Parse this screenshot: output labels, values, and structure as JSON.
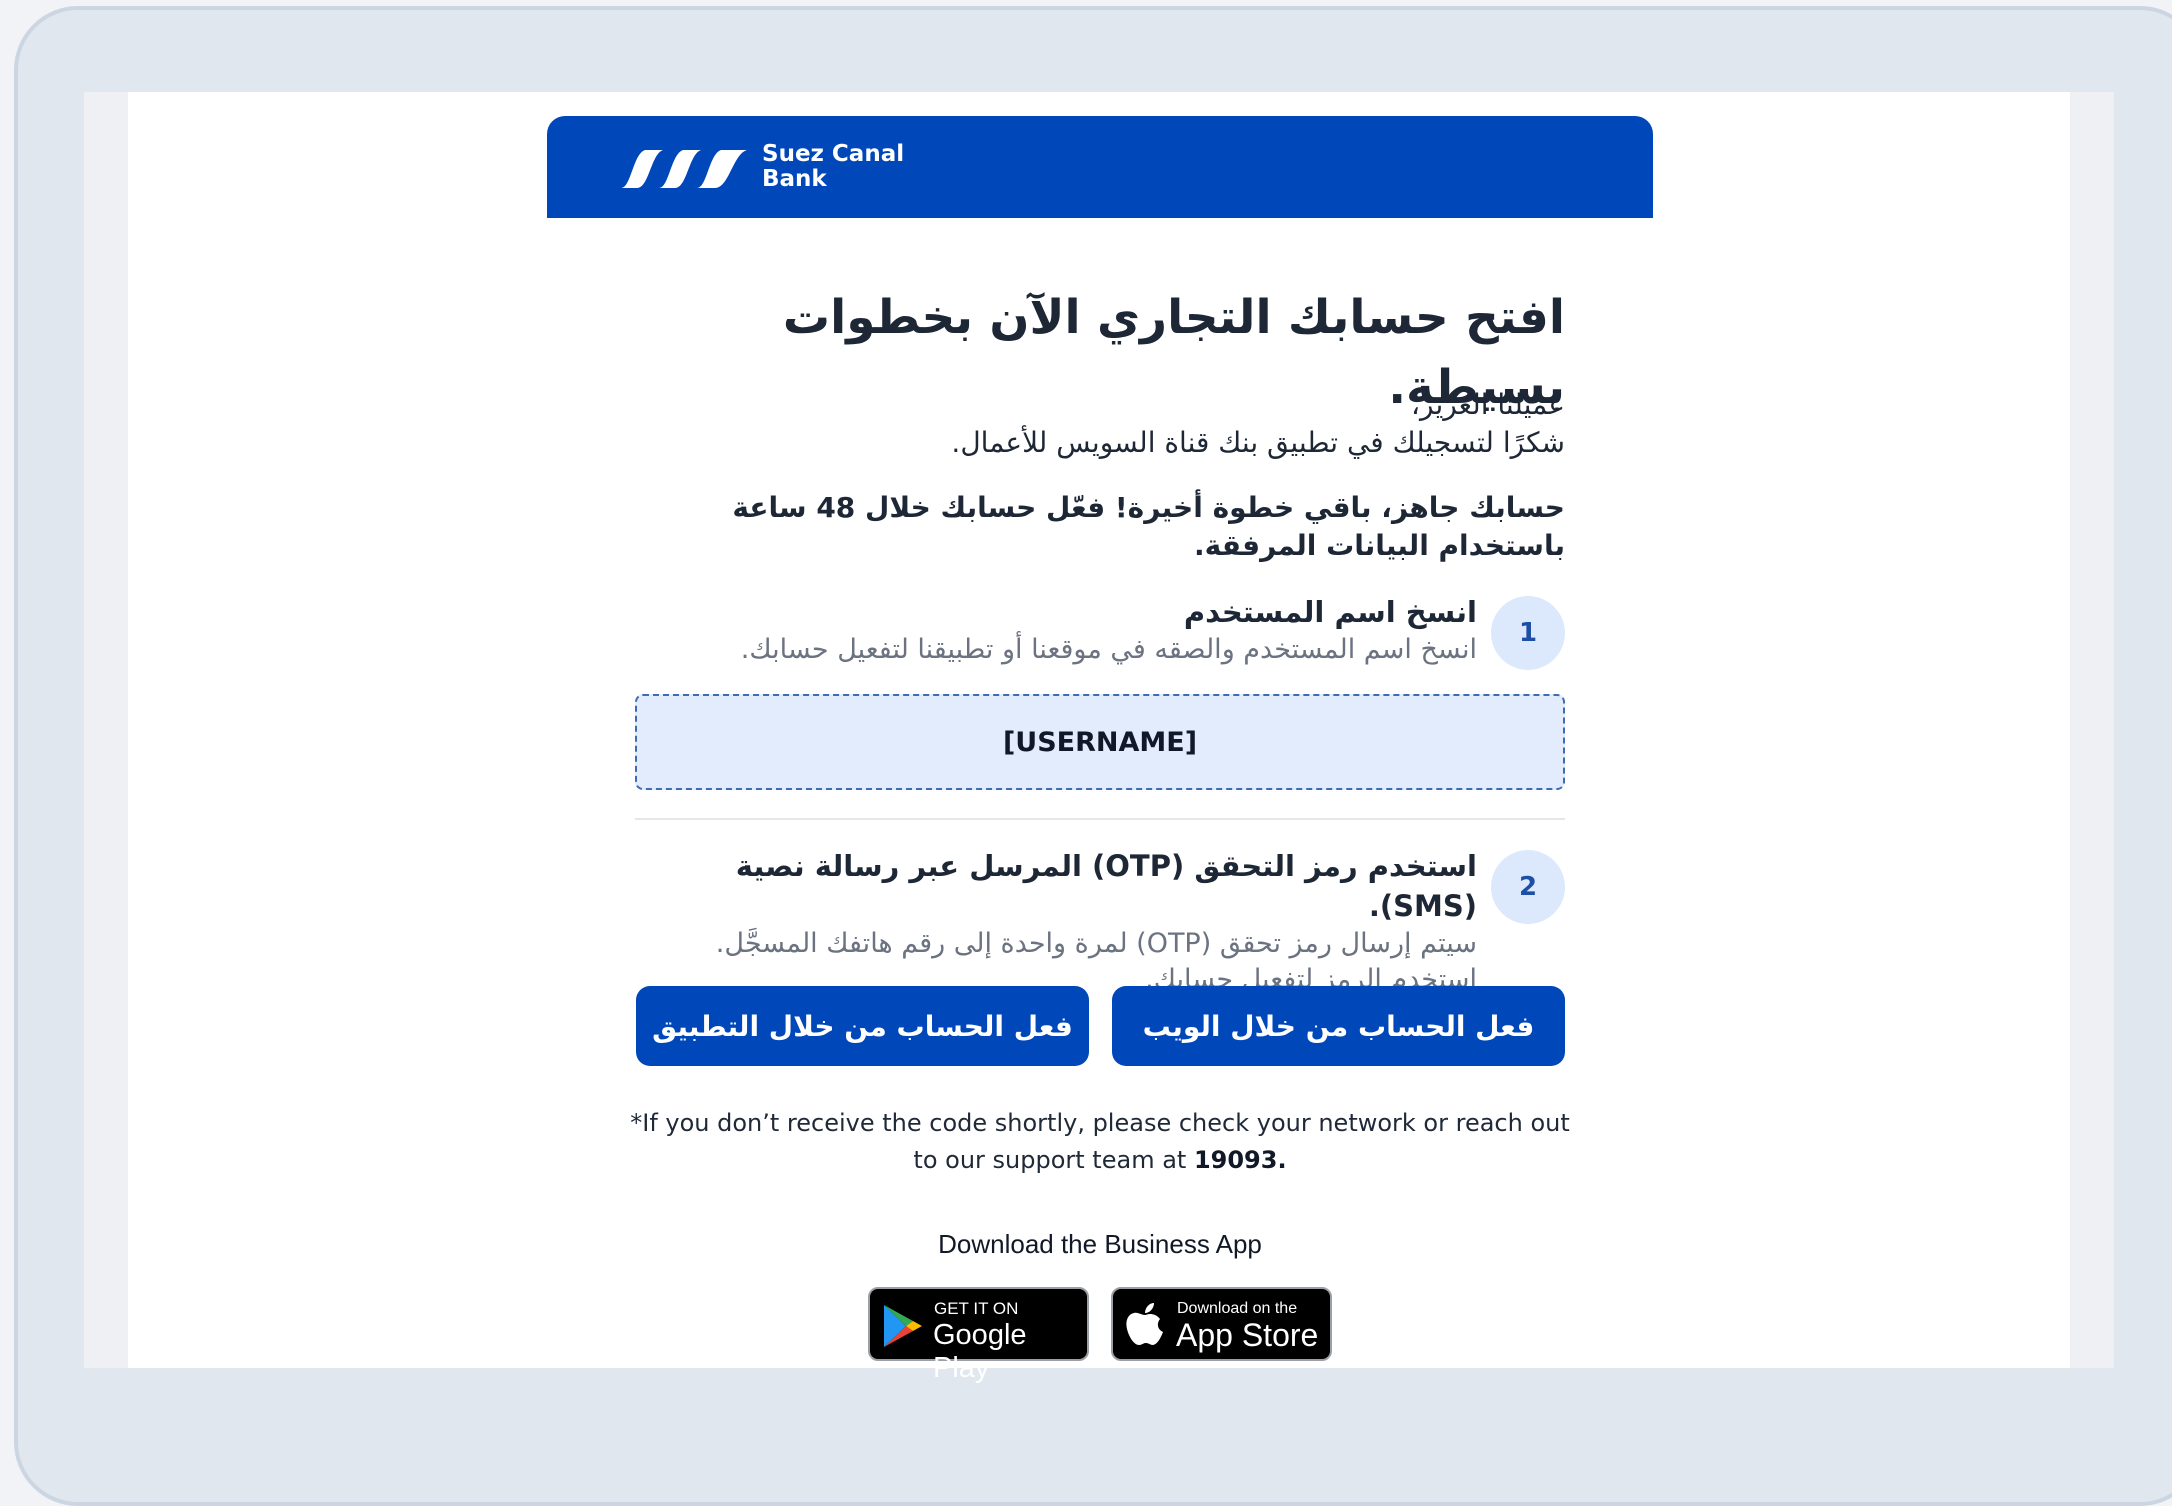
{
  "brand": {
    "name_line1": "Suez Canal",
    "name_line2": "Bank",
    "primary_color": "#0047ba"
  },
  "headline": "افتح حسابك التجاري الآن بخطوات بسيطة.",
  "greeting": {
    "salutation": "عميلنا العزيز،",
    "thanks": "شكرًا لتسجيلك في تطبيق بنك قناة السويس للأعمال."
  },
  "emphasis": "حسابك جاهز، باقي خطوة أخيرة! فعّل حسابك خلال 48 ساعة باستخدام البيانات المرفقة.",
  "steps": [
    {
      "number": "1",
      "title": "انسخ اسم المستخدم",
      "description": "انسخ اسم المستخدم والصقه في موقعنا أو تطبيقنا لتفعيل حسابك."
    },
    {
      "number": "2",
      "title": "استخدم رمز التحقق (OTP) المرسل عبر رسالة نصية (SMS).",
      "description_line1": "سيتم إرسال رمز تحقق (OTP) لمرة واحدة إلى رقم هاتفك المسجَّل.",
      "description_line2": "استخدم الرمز لتفعيل حسابك."
    }
  ],
  "username_placeholder": "[USERNAME]",
  "buttons": {
    "activate_web": "فعل الحساب من خلال الويب",
    "activate_app": "فعل الحساب من خلال التطبيق"
  },
  "support_note": {
    "text_before": "*If you don’t receive the code shortly, please check your network or reach out to our support team at ",
    "phone": "19093."
  },
  "download": {
    "title": "Download the Business App",
    "google_play": {
      "small": "GET IT ON",
      "big": "Google Play",
      "icon": "google-play-icon"
    },
    "app_store": {
      "small": "Download on the",
      "big": "App Store",
      "icon": "apple-icon"
    }
  }
}
